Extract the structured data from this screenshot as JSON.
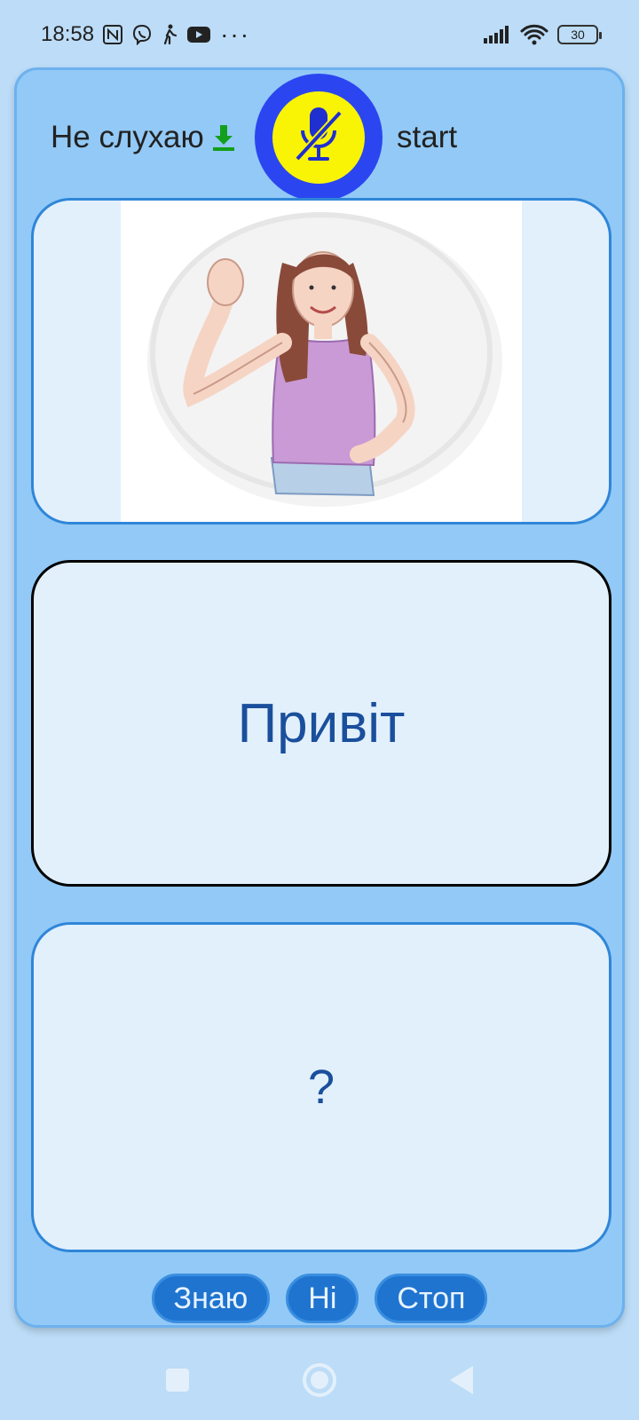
{
  "status_bar": {
    "time": "18:58",
    "left_icons": [
      "nfc-icon",
      "viber-icon",
      "walking-icon",
      "youtube-icon",
      "more-dots-icon"
    ],
    "more_dots": "···",
    "right_icons": [
      "signal-icon",
      "wifi-icon",
      "battery-icon"
    ],
    "battery_level": "30"
  },
  "header": {
    "listen_status": "Не слухаю",
    "download_icon": "download-arrow-icon",
    "mic_icon": "mic-off-icon",
    "start_label": "start",
    "colors": {
      "mic_ring": "#2b46f0",
      "mic_fill": "#f9f405",
      "mic_glyph": "#1f2fd0",
      "download": "#139f1b"
    }
  },
  "cards": {
    "image_alt": "waving-woman-illustration",
    "word": "Привіт",
    "answer": "?"
  },
  "buttons": {
    "know": "Знаю",
    "no": "Ні",
    "stop": "Стоп"
  },
  "nav": {
    "icons": [
      "recent-apps-icon",
      "home-icon",
      "back-icon"
    ]
  }
}
